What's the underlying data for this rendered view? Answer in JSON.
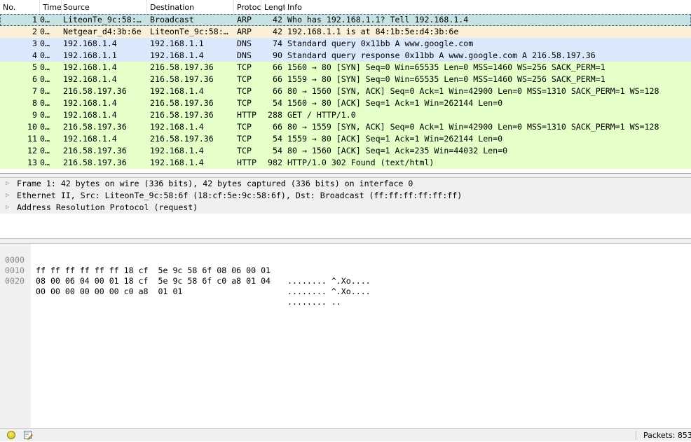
{
  "packet_list": {
    "columns": [
      {
        "key": "no",
        "label": "No."
      },
      {
        "key": "time",
        "label": "Time"
      },
      {
        "key": "source",
        "label": "Source"
      },
      {
        "key": "destination",
        "label": "Destination"
      },
      {
        "key": "protocol",
        "label": "Protoc"
      },
      {
        "key": "length",
        "label": "Lengt"
      },
      {
        "key": "info",
        "label": "Info"
      }
    ],
    "rows": [
      {
        "no": "1",
        "time": "0…",
        "source": "LiteonTe_9c:58:…",
        "destination": "Broadcast",
        "protocol": "ARP",
        "length": "42",
        "info": "Who has 192.168.1.1? Tell 192.168.1.4",
        "color": "#c7e2e3",
        "selected": true
      },
      {
        "no": "2",
        "time": "0…",
        "source": "Netgear_d4:3b:6e",
        "destination": "LiteonTe_9c:58:…",
        "protocol": "ARP",
        "length": "42",
        "info": "192.168.1.1 is at 84:1b:5e:d4:3b:6e",
        "color": "#faf0d7"
      },
      {
        "no": "3",
        "time": "0…",
        "source": "192.168.1.4",
        "destination": "192.168.1.1",
        "protocol": "DNS",
        "length": "74",
        "info": "Standard query 0x11bb A www.google.com",
        "color": "#dae8fc"
      },
      {
        "no": "4",
        "time": "0…",
        "source": "192.168.1.1",
        "destination": "192.168.1.4",
        "protocol": "DNS",
        "length": "90",
        "info": "Standard query response 0x11bb A www.google.com A 216.58.197.36",
        "color": "#dae8fc"
      },
      {
        "no": "5",
        "time": "0…",
        "source": "192.168.1.4",
        "destination": "216.58.197.36",
        "protocol": "TCP",
        "length": "66",
        "info": "1560 → 80 [SYN] Seq=0 Win=65535 Len=0 MSS=1460 WS=256 SACK_PERM=1",
        "color": "#e4ffc7"
      },
      {
        "no": "6",
        "time": "0…",
        "source": "192.168.1.4",
        "destination": "216.58.197.36",
        "protocol": "TCP",
        "length": "66",
        "info": "1559 → 80 [SYN] Seq=0 Win=65535 Len=0 MSS=1460 WS=256 SACK_PERM=1",
        "color": "#e4ffc7"
      },
      {
        "no": "7",
        "time": "0…",
        "source": "216.58.197.36",
        "destination": "192.168.1.4",
        "protocol": "TCP",
        "length": "66",
        "info": "80 → 1560 [SYN, ACK] Seq=0 Ack=1 Win=42900 Len=0 MSS=1310 SACK_PERM=1 WS=128",
        "color": "#e4ffc7"
      },
      {
        "no": "8",
        "time": "0…",
        "source": "192.168.1.4",
        "destination": "216.58.197.36",
        "protocol": "TCP",
        "length": "54",
        "info": "1560 → 80 [ACK] Seq=1 Ack=1 Win=262144 Len=0",
        "color": "#e4ffc7"
      },
      {
        "no": "9",
        "time": "0…",
        "source": "192.168.1.4",
        "destination": "216.58.197.36",
        "protocol": "HTTP",
        "length": "288",
        "info": "GET / HTTP/1.0",
        "color": "#e4ffc7"
      },
      {
        "no": "10",
        "time": "0…",
        "source": "216.58.197.36",
        "destination": "192.168.1.4",
        "protocol": "TCP",
        "length": "66",
        "info": "80 → 1559 [SYN, ACK] Seq=0 Ack=1 Win=42900 Len=0 MSS=1310 SACK_PERM=1 WS=128",
        "color": "#e4ffc7"
      },
      {
        "no": "11",
        "time": "0…",
        "source": "192.168.1.4",
        "destination": "216.58.197.36",
        "protocol": "TCP",
        "length": "54",
        "info": "1559 → 80 [ACK] Seq=1 Ack=1 Win=262144 Len=0",
        "color": "#e4ffc7"
      },
      {
        "no": "12",
        "time": "0…",
        "source": "216.58.197.36",
        "destination": "192.168.1.4",
        "protocol": "TCP",
        "length": "54",
        "info": "80 → 1560 [ACK] Seq=1 Ack=235 Win=44032 Len=0",
        "color": "#e4ffc7"
      },
      {
        "no": "13",
        "time": "0…",
        "source": "216.58.197.36",
        "destination": "192.168.1.4",
        "protocol": "HTTP",
        "length": "982",
        "info": "HTTP/1.0 302 Found  (text/html)",
        "color": "#e4ffc7"
      }
    ]
  },
  "details": {
    "items": [
      {
        "text": "Frame 1: 42 bytes on wire (336 bits), 42 bytes captured (336 bits) on interface 0",
        "arrow": "▷"
      },
      {
        "text": "Ethernet II, Src: LiteonTe_9c:58:6f (18:cf:5e:9c:58:6f), Dst: Broadcast (ff:ff:ff:ff:ff:ff)",
        "arrow": "▷"
      },
      {
        "text": "Address Resolution Protocol (request)",
        "arrow": "▷"
      }
    ]
  },
  "bytes": {
    "lines": [
      {
        "offset": "0000",
        "hex": "ff ff ff ff ff ff 18 cf  5e 9c 58 6f 08 06 00 01",
        "ascii": "........ ^.Xo...."
      },
      {
        "offset": "0010",
        "hex": "08 00 06 04 00 01 18 cf  5e 9c 58 6f c0 a8 01 04",
        "ascii": "........ ^.Xo...."
      },
      {
        "offset": "0020",
        "hex": "00 00 00 00 00 00 c0 a8  01 01",
        "ascii": "........ .."
      }
    ]
  },
  "statusbar": {
    "ready_icon": "status-led-icon",
    "edit_icon": "edit-comment-icon",
    "packets_text": "Packets: 853"
  }
}
